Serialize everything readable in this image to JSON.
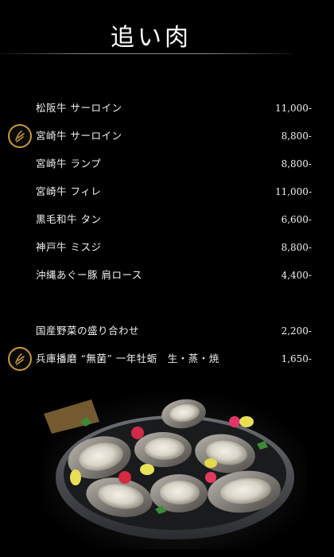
{
  "menu": {
    "title": "追い肉",
    "items": [
      {
        "name": "松阪牛 サーロイン",
        "price": "11,000-"
      },
      {
        "name": "宮崎牛 サーロイン",
        "price": "8,800-"
      },
      {
        "name": "宮崎牛 ランプ",
        "price": "8,800-"
      },
      {
        "name": "宮崎牛 フィレ",
        "price": "11,000-"
      },
      {
        "name": "黒毛和牛 タン",
        "price": "6,600-"
      },
      {
        "name": "神戸牛 ミスジ",
        "price": "8,800-"
      },
      {
        "name": "沖縄あぐー豚 肩ロース",
        "price": "4,400-"
      }
    ],
    "extras": [
      {
        "name": "国産野菜の盛り合わせ",
        "price": "2,200-"
      },
      {
        "name": "兵庫播磨 “無菌” 一年牡蛎　生・蒸・焼",
        "price": "1,650-"
      }
    ]
  },
  "icons": {
    "emblem": "recommended-emblem-icon"
  },
  "colors": {
    "background": "#000000",
    "text": "#f0f0f0",
    "emblem_gold": "#c69a38"
  }
}
